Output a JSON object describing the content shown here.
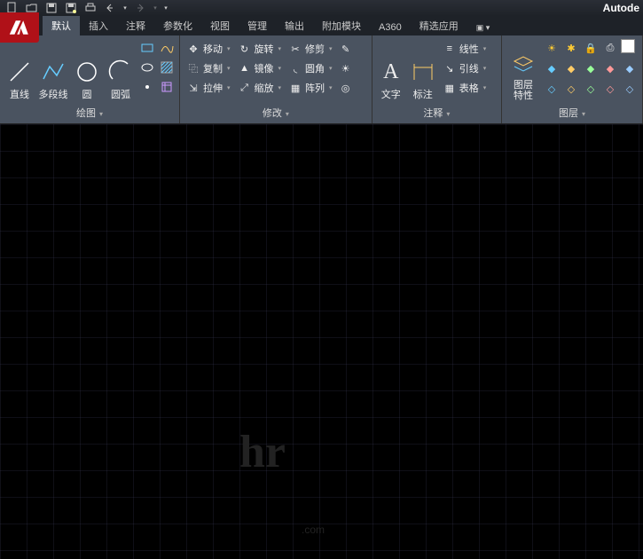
{
  "app": {
    "brand": "Autode"
  },
  "tabs": {
    "items": [
      "默认",
      "插入",
      "注释",
      "参数化",
      "视图",
      "管理",
      "输出",
      "附加模块",
      "A360",
      "精选应用"
    ],
    "active": 0
  },
  "draw": {
    "title": "绘图",
    "line": "直线",
    "polyline": "多段线",
    "circle": "圆",
    "arc": "圆弧"
  },
  "modify": {
    "title": "修改",
    "move": "移动",
    "rotate": "旋转",
    "trim": "修剪",
    "copy": "复制",
    "mirror": "镜像",
    "fillet": "圆角",
    "stretch": "拉伸",
    "scale": "缩放",
    "array": "阵列"
  },
  "annot": {
    "title": "注释",
    "text": "文字",
    "dim": "标注",
    "linetype": "线性",
    "leader": "引线",
    "table": "表格"
  },
  "layer": {
    "title": "图层",
    "props": "图层\n特性"
  },
  "wm": {
    "logo": "hr",
    "sub": ".com"
  }
}
